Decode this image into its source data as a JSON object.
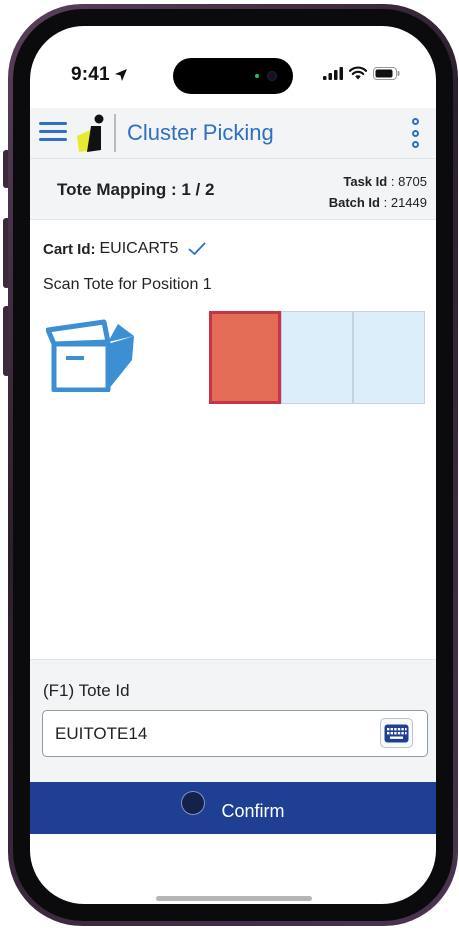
{
  "status_bar": {
    "time": "9:41",
    "icons": [
      "location-arrow-icon",
      "cellular-signal-icon",
      "wifi-icon",
      "battery-icon"
    ]
  },
  "header": {
    "title": "Cluster Picking",
    "icons": [
      "hamburger-menu-icon",
      "app-logo",
      "more-vertical-icon"
    ],
    "accent_color": "#2f6fc6"
  },
  "task_header": {
    "title": "Tote Mapping : 1 / 2",
    "task_id_label": "Task Id",
    "task_id_value": ": 8705",
    "batch_id_label": "Batch Id",
    "batch_id_value": ": 21449"
  },
  "cart": {
    "label": "Cart Id:",
    "value": "EUICART5",
    "status_icon": "checkmark-icon"
  },
  "instruction": "Scan Tote for Position 1",
  "tote_slots": [
    {
      "state": "active",
      "color": "#e36c57"
    },
    {
      "state": "empty",
      "color": "#dbeef9"
    },
    {
      "state": "empty",
      "color": "#dbeef9"
    }
  ],
  "entry": {
    "field_label": "(F1) Tote Id",
    "field_value": "EUITOTE14",
    "keyboard_icon": "keyboard-icon"
  },
  "confirm": {
    "label": "Confirm",
    "color": "#1f3f93"
  }
}
